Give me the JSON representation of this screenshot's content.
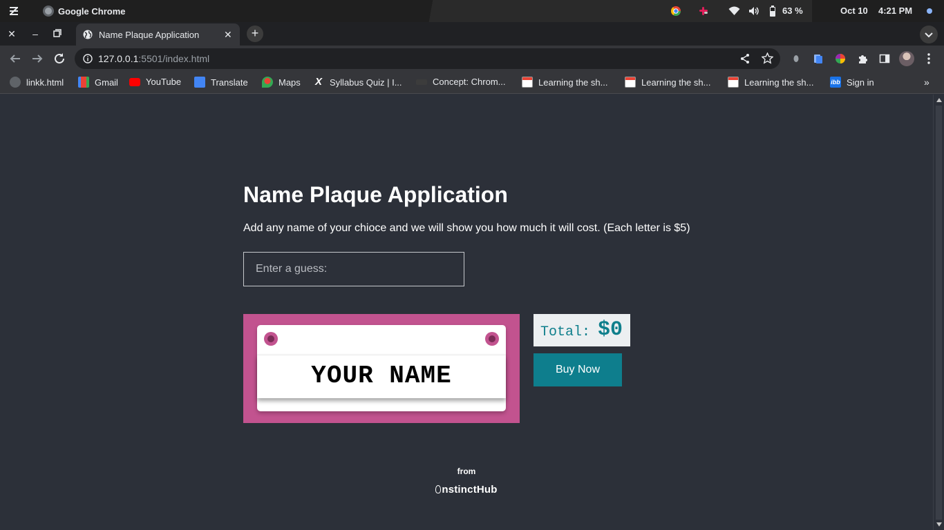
{
  "os": {
    "app_name": "Google Chrome",
    "battery": "63 %",
    "date": "Oct 10",
    "time": "4:21 PM"
  },
  "tab": {
    "title": "Name Plaque Application"
  },
  "omnibox": {
    "url_host": "127.0.0.1",
    "url_rest": ":5501/index.html"
  },
  "bookmarks": [
    {
      "label": "linkk.html",
      "icon": "globe-icon",
      "color": "#5f6368"
    },
    {
      "label": "Gmail",
      "icon": "gmail-icon",
      "color": "#ea4335"
    },
    {
      "label": "YouTube",
      "icon": "youtube-icon",
      "color": "#ff0000"
    },
    {
      "label": "Translate",
      "icon": "translate-icon",
      "color": "#4285f4"
    },
    {
      "label": "Maps",
      "icon": "maps-icon",
      "color": "#34a853"
    },
    {
      "label": "Syllabus Quiz | I...",
      "icon": "x-icon",
      "color": "#ffffff"
    },
    {
      "label": "Concept: Chrom...",
      "icon": "concept-icon",
      "color": "#5f6368"
    },
    {
      "label": "Learning the sh...",
      "icon": "doc-icon",
      "color": "#ea4335"
    },
    {
      "label": "Learning the sh...",
      "icon": "doc-icon",
      "color": "#ea4335"
    },
    {
      "label": "Learning the sh...",
      "icon": "doc-icon",
      "color": "#ea4335"
    },
    {
      "label": "Sign in",
      "icon": "ibb-icon",
      "color": "#1a73e8"
    }
  ],
  "page": {
    "heading": "Name Plaque Application",
    "description": "Add any name of your chioce and we will show you how much it will cost. (Each letter is $5)",
    "input_placeholder": "Enter a guess:",
    "input_value": "",
    "plaque_name": "YOUR NAME",
    "total_label": "Total:",
    "total_amount": "$0",
    "buy_label": "Buy Now",
    "from_label": "from",
    "brand": "nstinctHub",
    "colors": {
      "background": "#2c3039",
      "plaque_frame": "#c2538f",
      "accent": "#0e7e8d"
    }
  }
}
